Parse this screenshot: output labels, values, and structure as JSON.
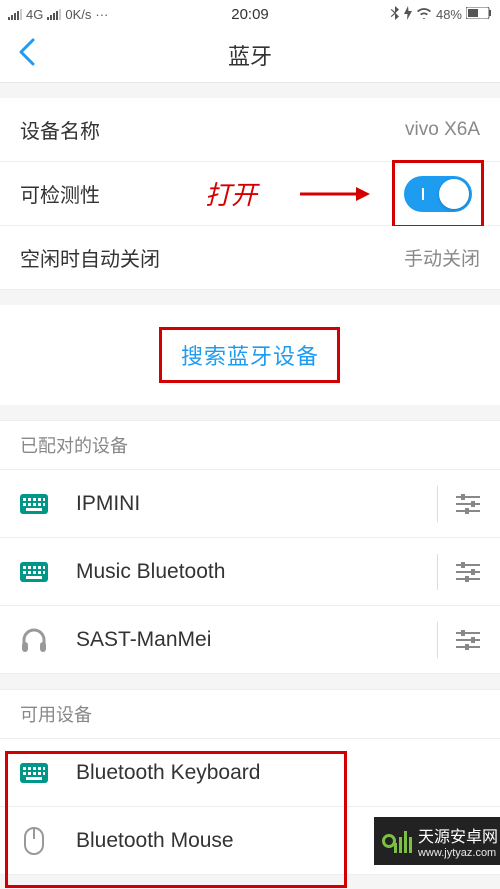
{
  "status_bar": {
    "network_type": "4G",
    "speed": "0K/s",
    "time": "20:09",
    "battery_pct": "48%"
  },
  "header": {
    "title": "蓝牙"
  },
  "settings": {
    "device_name": {
      "label": "设备名称",
      "value": "vivo X6A"
    },
    "discoverable": {
      "label": "可检测性",
      "on": true
    },
    "idle_off": {
      "label": "空闲时自动关闭",
      "value": "手动关闭"
    }
  },
  "annotations": {
    "open_label": "打开"
  },
  "search_button": "搜索蓝牙设备",
  "paired": {
    "header": "已配对的设备",
    "items": [
      {
        "name": "IPMINI",
        "icon": "keyboard"
      },
      {
        "name": "Music Bluetooth",
        "icon": "keyboard"
      },
      {
        "name": "SAST-ManMei",
        "icon": "headphones"
      }
    ]
  },
  "available": {
    "header": "可用设备",
    "items": [
      {
        "name": "Bluetooth  Keyboard",
        "icon": "keyboard"
      },
      {
        "name": "Bluetooth Mouse",
        "icon": "mouse"
      }
    ]
  },
  "watermark": {
    "name": "天源安卓网",
    "url": "www.jytyaz.com"
  }
}
